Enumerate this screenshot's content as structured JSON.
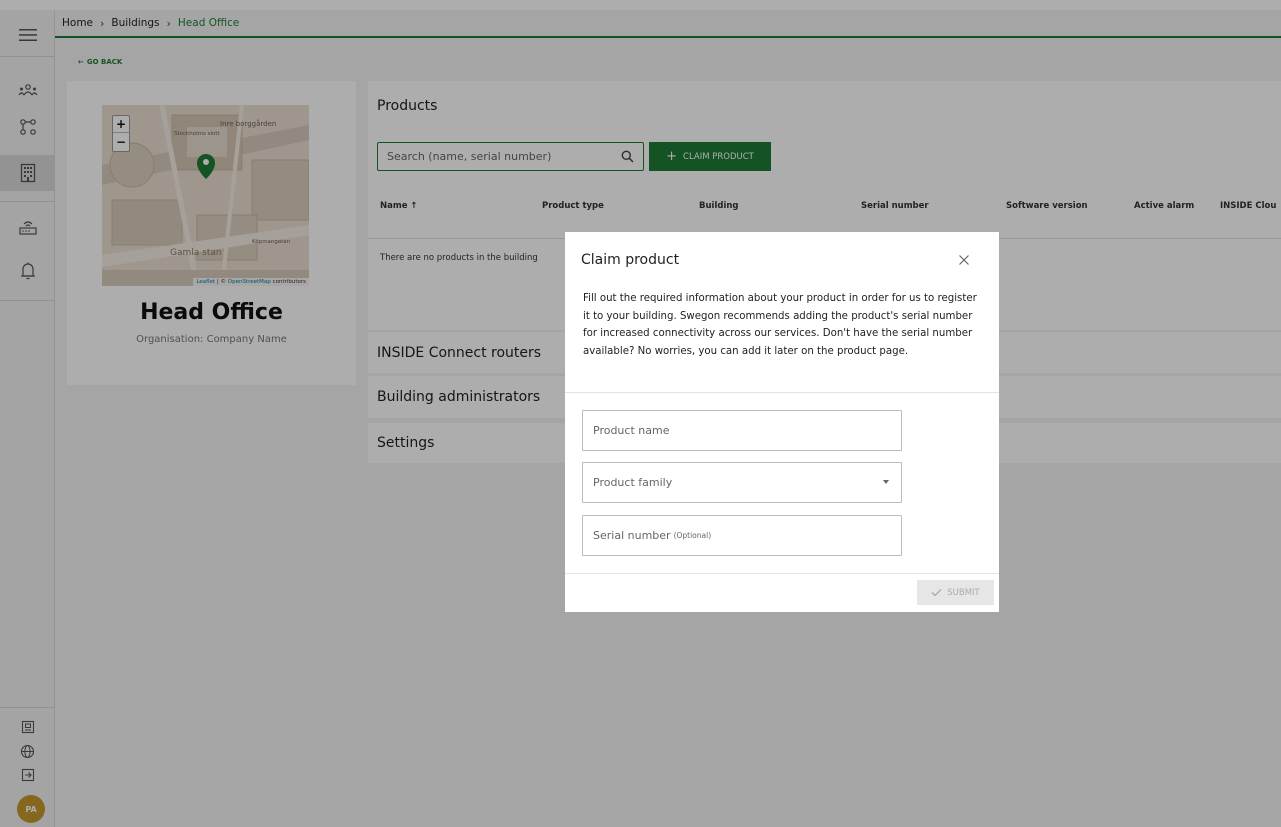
{
  "theme": {
    "accent": "#1e7b34",
    "avatar_bg": "#c49a2c"
  },
  "breadcrumb": {
    "items": [
      "Home",
      "Buildings"
    ],
    "current": "Head Office",
    "separator": "›"
  },
  "goback": {
    "label": "GO BACK",
    "arrow": "←"
  },
  "sidebar": {
    "icons": [
      "menu-icon",
      "users-icon",
      "network-icon",
      "building-icon",
      "router-icon",
      "bell-icon"
    ],
    "bottom_icons": [
      "id-card-icon",
      "globe-icon",
      "logout-icon"
    ],
    "avatar": "PA"
  },
  "building": {
    "name": "Head Office",
    "organisation": "Organisation: Company Name",
    "map": {
      "zoom_in": "+",
      "zoom_out": "−",
      "labels": [
        "Inre borggården",
        "Gamla stan",
        "Stockholms slott",
        "Köpmangatan"
      ],
      "attribution_leaflet": "Leaflet",
      "attribution_sep": "| ©",
      "attribution_osm": "OpenStreetMap",
      "attribution_tail": "contributors"
    }
  },
  "products": {
    "title": "Products",
    "search_placeholder": "Search (name, serial number)",
    "claim_label": "CLAIM PRODUCT",
    "columns": [
      "Name ↑",
      "Product type",
      "Building",
      "Serial number",
      "Software version",
      "Active alarm",
      "INSIDE Clou"
    ],
    "empty_text": "There are no products in the building"
  },
  "sections": [
    "INSIDE Connect routers",
    "Building administrators",
    "Settings"
  ],
  "modal": {
    "title": "Claim product",
    "description": "Fill out the required information about your product in order for us to register it to your building. Swegon recommends adding the product's serial number for increased connectivity across our services. Don't have the serial number available? No worries, you can add it later on the product page.",
    "fields": {
      "product_name": "Product name",
      "product_family": "Product family",
      "serial_number": "Serial number",
      "serial_optional": "(Optional)"
    },
    "submit_label": "SUBMIT"
  }
}
